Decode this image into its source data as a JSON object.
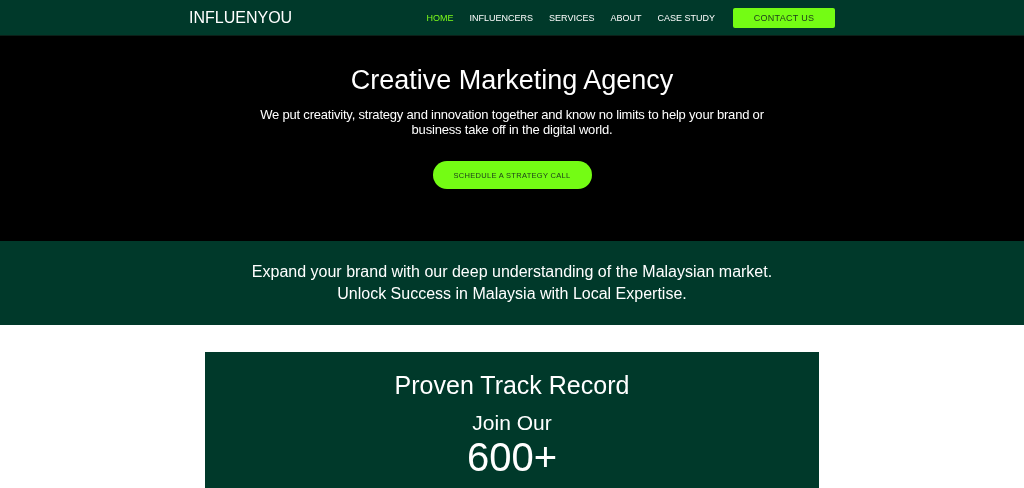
{
  "header": {
    "logo": "INFLUENYOU",
    "nav": [
      {
        "label": "HOME",
        "selected": true
      },
      {
        "label": "INFLUENCERS",
        "selected": false
      },
      {
        "label": "SERVICES",
        "selected": false
      },
      {
        "label": "ABOUT",
        "selected": false
      },
      {
        "label": "CASE STUDY",
        "selected": false
      }
    ],
    "cta": "CONTACT US"
  },
  "hero": {
    "title": "Creative Marketing Agency",
    "text": "We put creativity, strategy and innovation together and know no limits to help your brand or business take off in the digital world.",
    "button": "SCHEDULE A STRATEGY CALL"
  },
  "band": {
    "lines": [
      "Expand your brand with our deep understanding of the Malaysian market.",
      "Unlock Success in Malaysia with Local Expertise."
    ]
  },
  "record": {
    "title": "Proven Track Record",
    "subtitle": "Join Our",
    "count": "600+"
  }
}
